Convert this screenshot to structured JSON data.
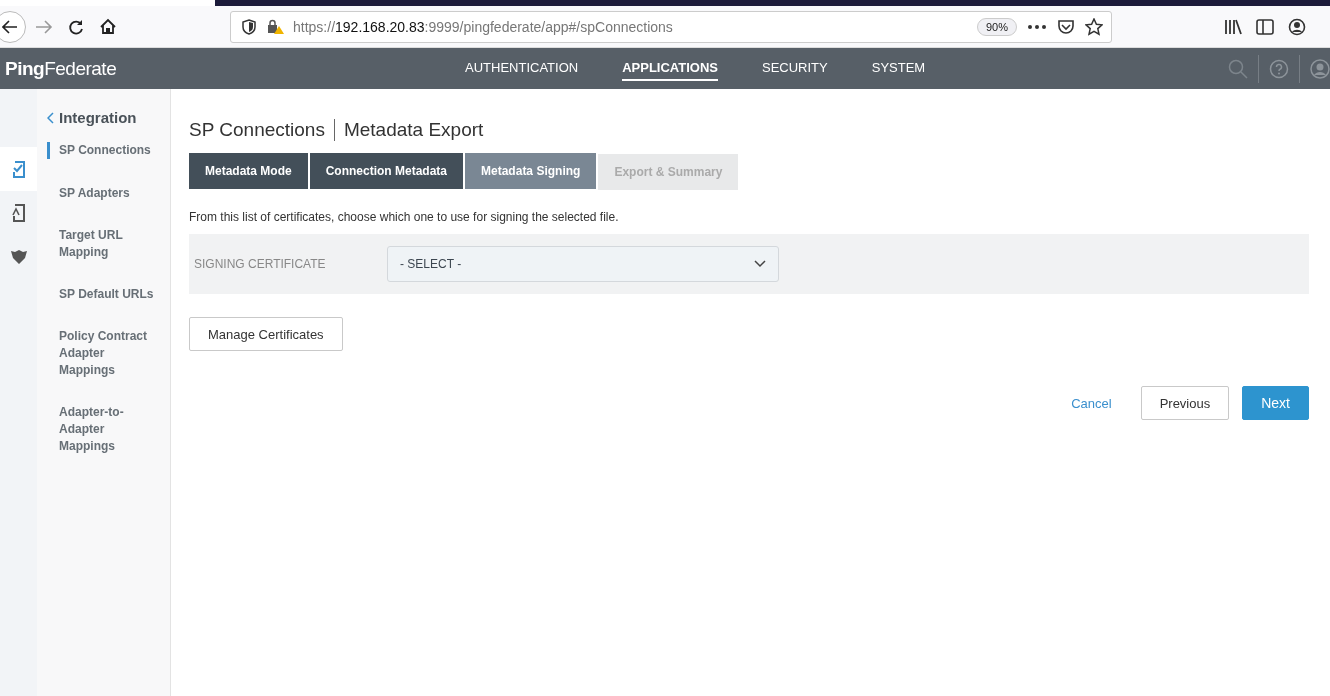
{
  "browser": {
    "url_scheme": "https://",
    "url_host": "192.168.20.83",
    "url_rest": ":9999/pingfederate/app#/spConnections",
    "zoom": "90%"
  },
  "app": {
    "logo_bold": "Ping",
    "logo_rest": "Federate",
    "nav": [
      {
        "label": "AUTHENTICATION",
        "selected": false
      },
      {
        "label": "APPLICATIONS",
        "selected": true
      },
      {
        "label": "SECURITY",
        "selected": false
      },
      {
        "label": "SYSTEM",
        "selected": false
      }
    ]
  },
  "rail": [
    {
      "kind": "connections",
      "selected": true
    },
    {
      "kind": "adapters",
      "selected": false
    },
    {
      "kind": "shield",
      "selected": false
    }
  ],
  "sidebar": {
    "back": "Integration",
    "items": [
      {
        "label": "SP Connections",
        "selected": true
      },
      {
        "label": "SP Adapters",
        "selected": false
      },
      {
        "label": "Target URL Mapping",
        "selected": false
      },
      {
        "label": "SP Default URLs",
        "selected": false
      },
      {
        "label": "Policy Contract Adapter Mappings",
        "selected": false
      },
      {
        "label": "Adapter-to-Adapter Mappings",
        "selected": false
      }
    ]
  },
  "page": {
    "title": "SP Connections",
    "subtitle": "Metadata Export",
    "steps": [
      {
        "label": "Metadata Mode",
        "selected": false,
        "disabled": false
      },
      {
        "label": "Connection Metadata",
        "selected": false,
        "disabled": false
      },
      {
        "label": "Metadata Signing",
        "selected": true,
        "disabled": false
      },
      {
        "label": "Export & Summary",
        "selected": false,
        "disabled": true
      }
    ],
    "description": "From this list of certificates, choose which one to use for signing the selected file.",
    "field_label": "SIGNING CERTIFICATE",
    "field_value": "- SELECT -",
    "manage_button": "Manage Certificates",
    "cancel": "Cancel",
    "previous": "Previous",
    "next": "Next"
  }
}
